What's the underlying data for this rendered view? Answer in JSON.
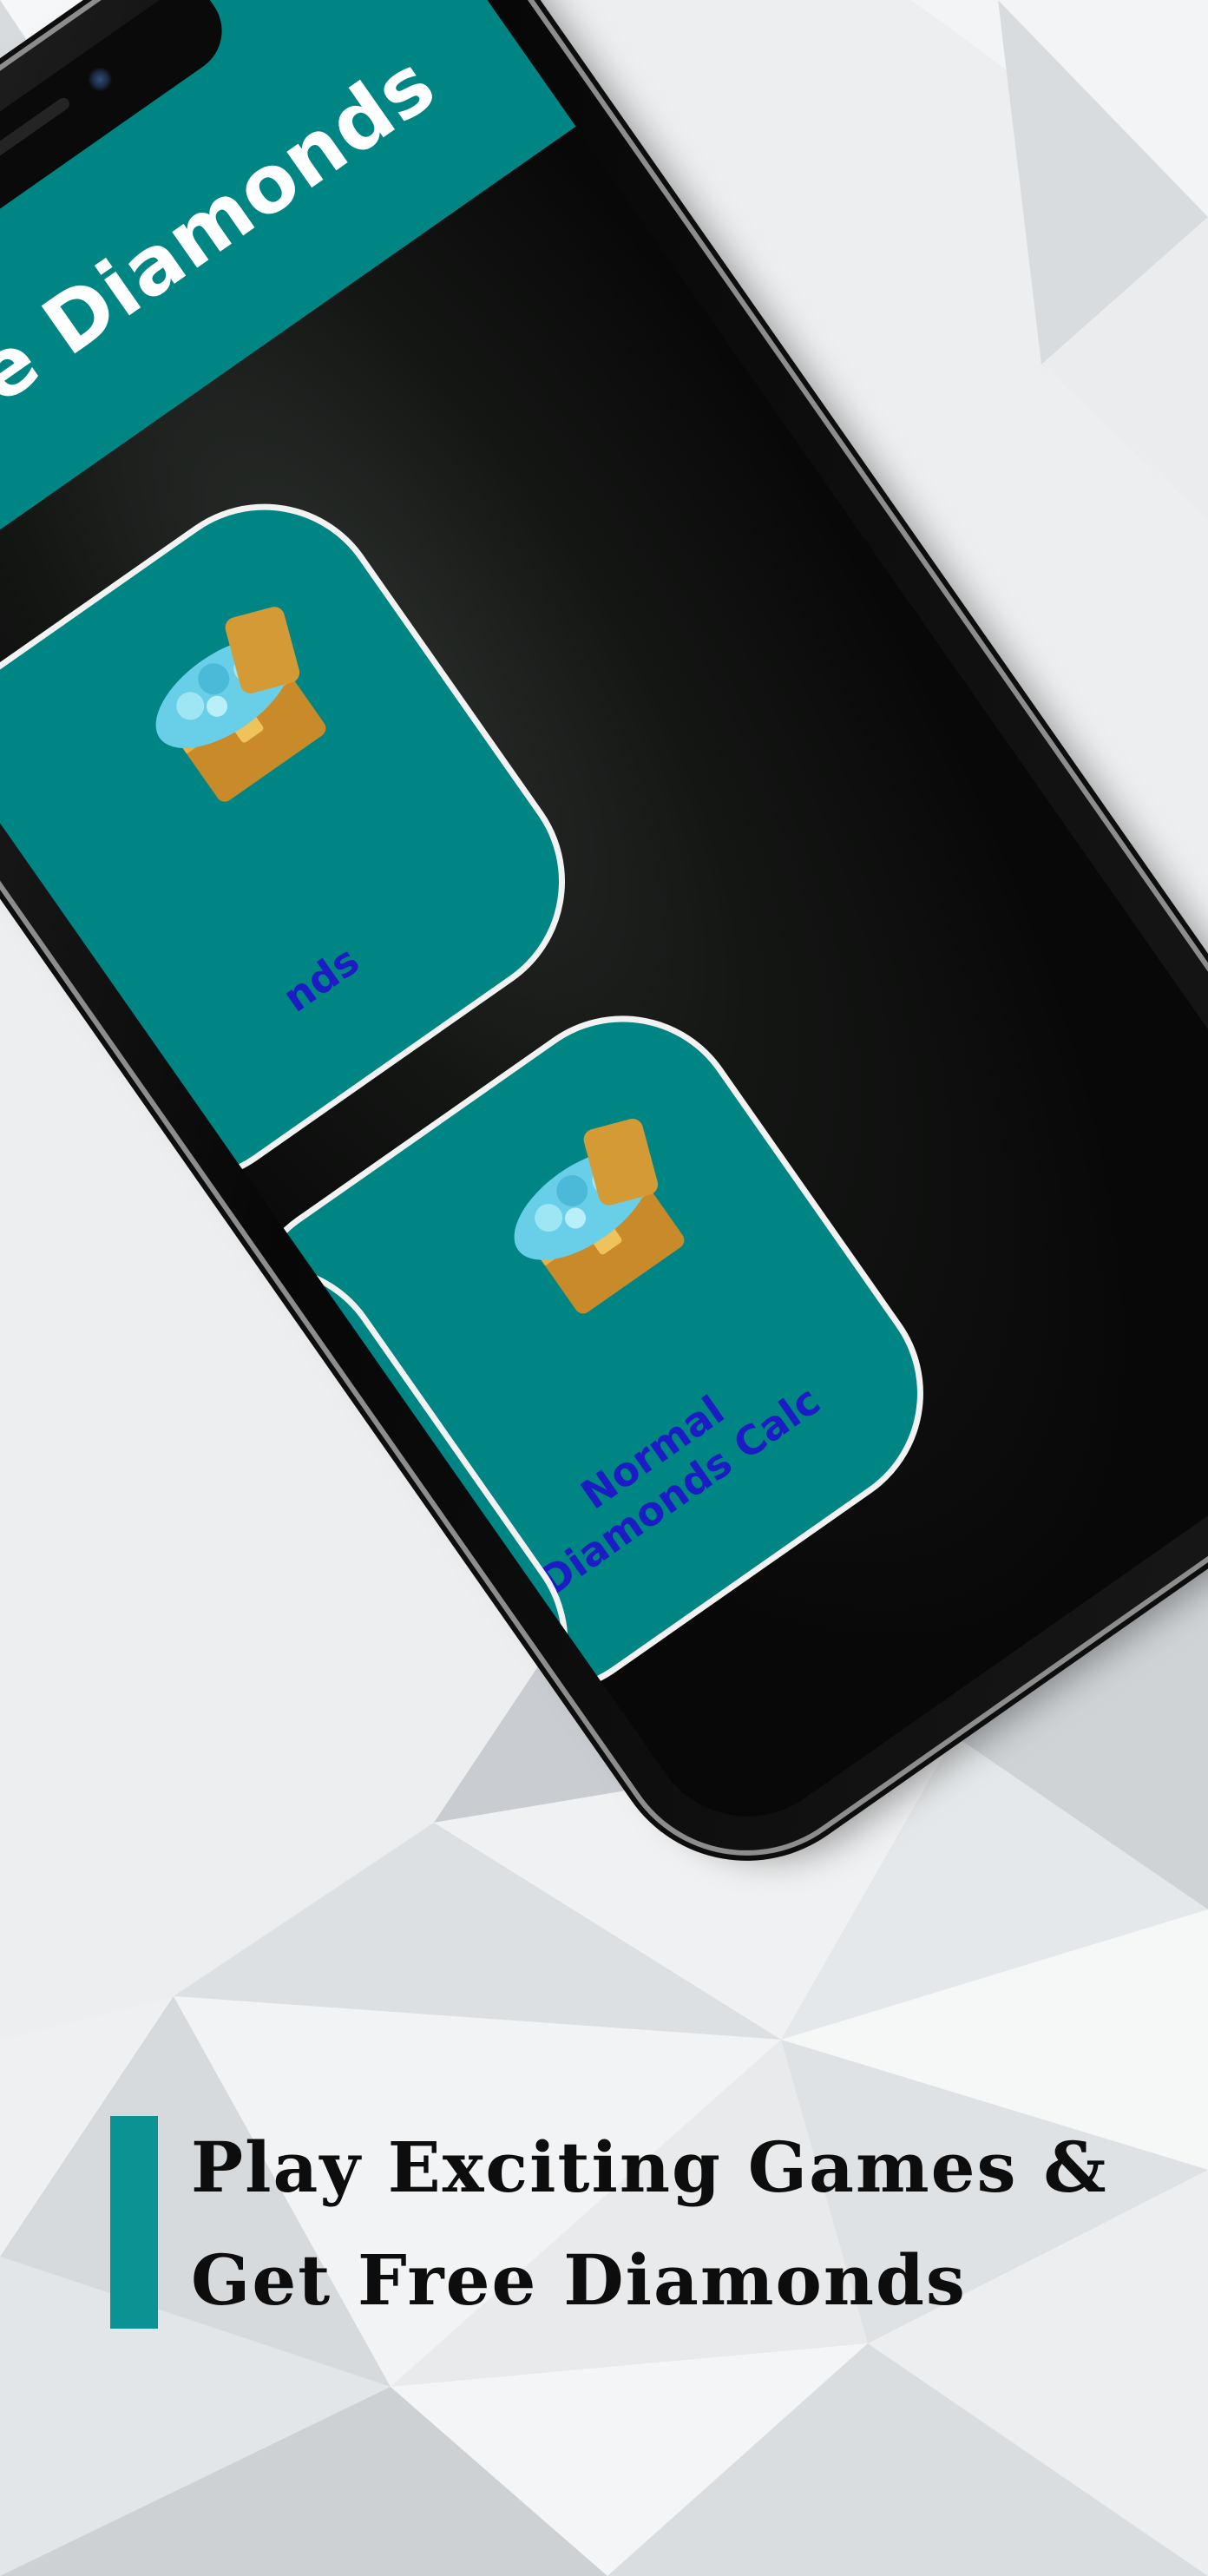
{
  "app": {
    "title": "Free Diamonds"
  },
  "cards": [
    {
      "label": "nds"
    },
    {
      "label": "Normal Diamonds Calc"
    },
    {
      "label": ""
    }
  ],
  "caption": {
    "line1": "Play Exciting Games &",
    "line2": "Get Free Diamonds"
  },
  "colors": {
    "header": "#008585",
    "card": "#008585",
    "card_label": "#1c1cc4",
    "accent_bar": "#0b9393",
    "background": "#e9ebec"
  },
  "icons": [
    "diamond-chest-icon",
    "diamond-chest-icon"
  ]
}
